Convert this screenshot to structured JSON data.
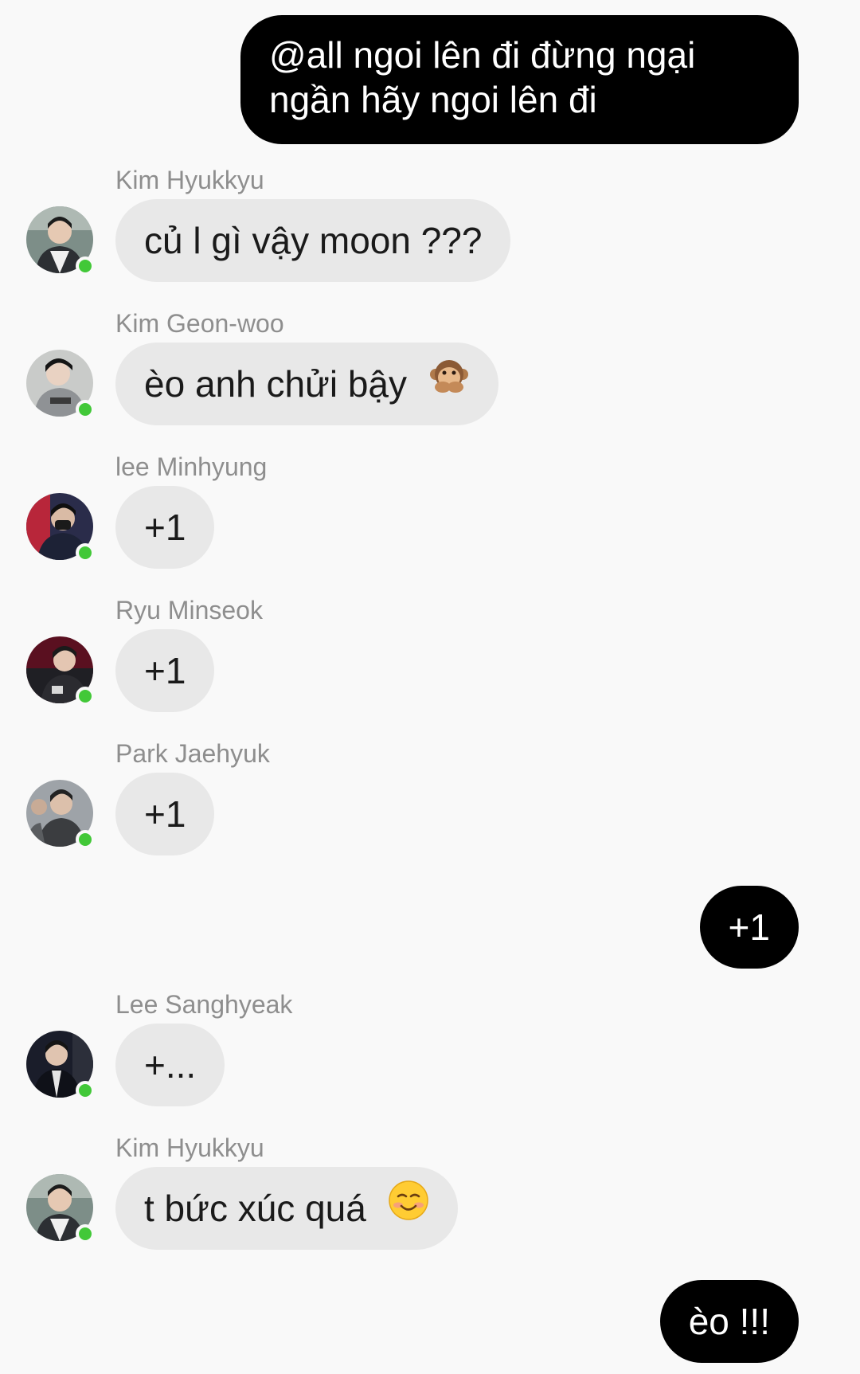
{
  "messages": [
    {
      "type": "sent",
      "text": "@all ngoi lên đi đừng ngại ngần hãy ngoi lên đi",
      "lines": [
        "@all ngoi lên đi đừng ngại",
        "ngần hãy ngoi lên đi"
      ]
    },
    {
      "type": "received",
      "sender": "Kim Hyukkyu",
      "text": "củ l gì vậy moon ???",
      "online": true
    },
    {
      "type": "received",
      "sender": "Kim Geon-woo",
      "text": "èo anh chửi bậy",
      "emoji": "speak-no-evil-monkey-icon",
      "online": true
    },
    {
      "type": "received",
      "sender": "lee Minhyung",
      "text": "+1",
      "online": true
    },
    {
      "type": "received",
      "sender": "Ryu Minseok",
      "text": "+1",
      "online": true
    },
    {
      "type": "received",
      "sender": "Park Jaehyuk",
      "text": "+1",
      "online": true
    },
    {
      "type": "sent",
      "text": "+1"
    },
    {
      "type": "received",
      "sender": "Lee Sanghyeak",
      "text": "+...",
      "online": true
    },
    {
      "type": "received",
      "sender": "Kim Hyukkyu",
      "text": "t bức xúc quá",
      "emoji": "smiling-face-icon",
      "online": true
    },
    {
      "type": "sent",
      "text": "èo !!!"
    }
  ],
  "colors": {
    "background": "#f9f9f9",
    "sent_bubble": "#000000",
    "received_bubble": "#e8e8e8",
    "online_indicator": "#42c838",
    "sender_name": "#8e8e8e"
  }
}
